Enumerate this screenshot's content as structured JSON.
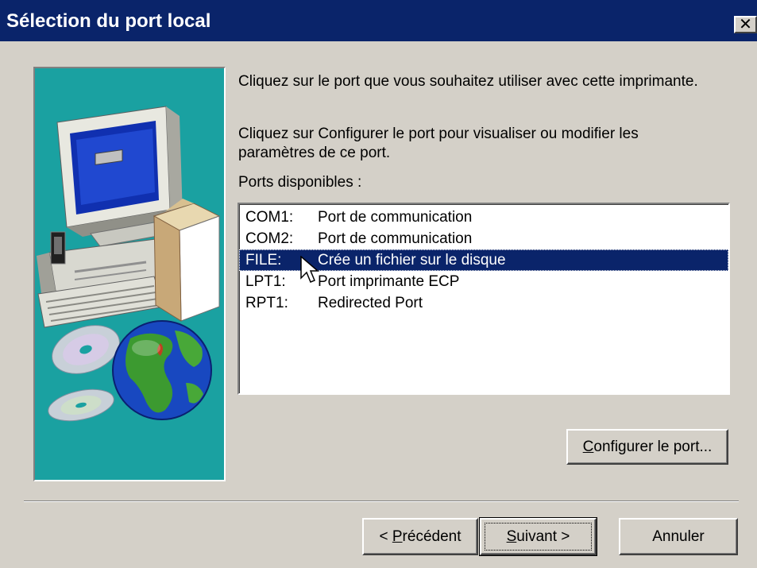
{
  "window": {
    "title": "Sélection du port local",
    "close_glyph": "✕"
  },
  "instructions": {
    "line1": "Cliquez sur le port que vous souhaitez utiliser avec cette imprimante.",
    "line2": "Cliquez sur Configurer le port pour visualiser ou modifier les paramètres de ce port.",
    "ports_label": "Ports disponibles :"
  },
  "ports": [
    {
      "name": "COM1:",
      "description": "Port de communication",
      "selected": false
    },
    {
      "name": "COM2:",
      "description": "Port de communication",
      "selected": false
    },
    {
      "name": "FILE:",
      "description": "Crée un fichier sur le disque",
      "selected": true
    },
    {
      "name": "LPT1:",
      "description": "Port imprimante ECP",
      "selected": false
    },
    {
      "name": "RPT1:",
      "description": "Redirected Port",
      "selected": false
    }
  ],
  "buttons": {
    "configure": {
      "accel": "C",
      "rest": "onfigurer le port..."
    },
    "back": {
      "prefix": "< ",
      "accel": "P",
      "rest": "récédent"
    },
    "next": {
      "accel": "S",
      "rest": "uivant >"
    },
    "cancel": "Annuler"
  },
  "icons": {
    "illustration": "computer-printer-globe-illustration",
    "cursor": "arrow-cursor-icon"
  },
  "colors": {
    "titlebar": "#0a246a",
    "face": "#d4d0c8",
    "selection": "#0a246a",
    "illustration_bg": "#1aa1a1"
  }
}
